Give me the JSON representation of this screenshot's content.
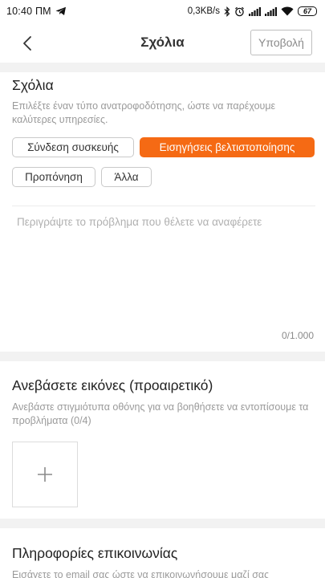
{
  "status_bar": {
    "time": "10:40 ΠΜ",
    "network_speed": "0,3KB/s",
    "battery_level": "67",
    "icons": [
      "telegram-icon",
      "bluetooth-icon",
      "alarm-icon",
      "signal-icon",
      "signal-icon",
      "wifi-icon",
      "battery-icon"
    ]
  },
  "header": {
    "title": "Σχόλια",
    "submit_label": "Υποβολή"
  },
  "feedback": {
    "title": "Σχόλια",
    "description": "Επιλέξτε έναν τύπο ανατροφοδότησης, ώστε να παρέχουμε καλύτερες υπηρεσίες.",
    "types": [
      {
        "label": "Σύνδεση συσκευής",
        "selected": false
      },
      {
        "label": "Εισηγήσεις βελτιστοποίησης",
        "selected": true
      },
      {
        "label": "Προπόνηση",
        "selected": false
      },
      {
        "label": "Άλλα",
        "selected": false
      }
    ],
    "textarea_placeholder": "Περιγράψτε το πρόβλημα που θέλετε να αναφέρετε",
    "char_counter": "0/1.000"
  },
  "images": {
    "title": "Ανεβάσετε εικόνες (προαιρετικό)",
    "description": "Ανεβάστε στιγμιότυπα οθόνης για να βοηθήσετε να εντοπίσουμε τα προβλήματα (0/4)"
  },
  "contact": {
    "title": "Πληροφορίες επικοινωνίας",
    "description": "Εισάγετε το email σας ώστε να επικοινωνήσουμε μαζί σας"
  },
  "colors": {
    "accent": "#f56a14",
    "background_band": "#f2f2f2",
    "muted_text": "#9a9a9a"
  }
}
